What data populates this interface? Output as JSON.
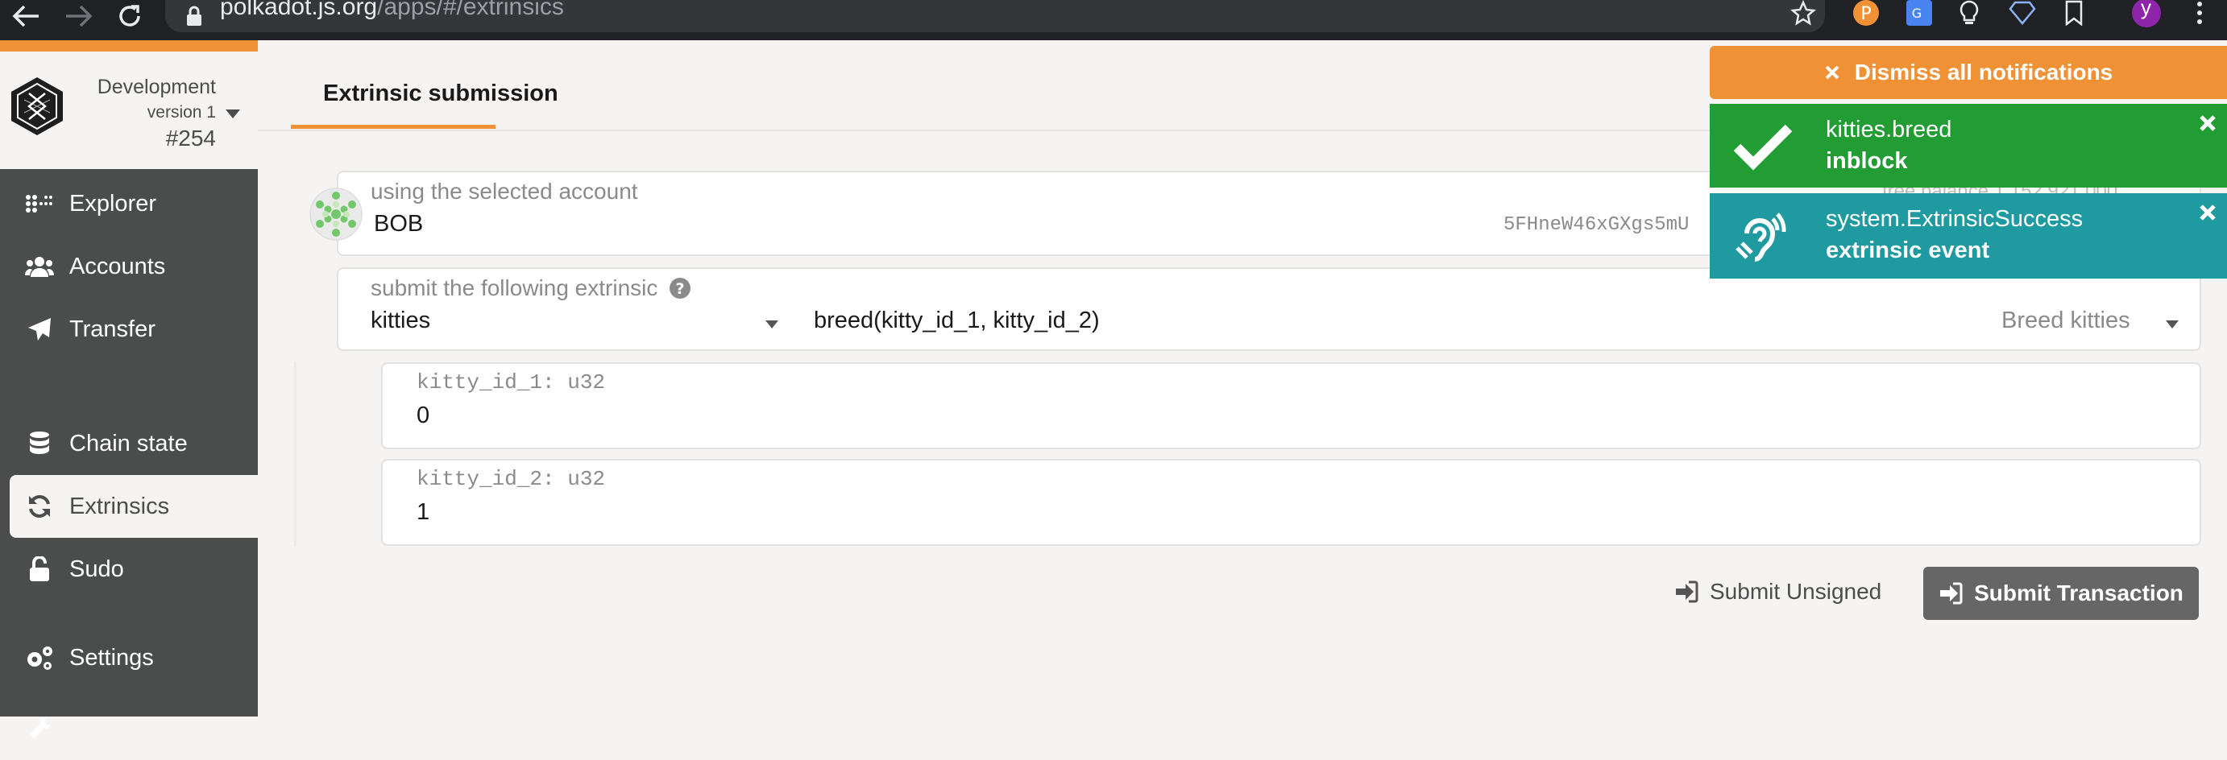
{
  "browser": {
    "url_host": "polkadot.js.org",
    "url_path": "/apps/#/extrinsics",
    "profile_initial": "y"
  },
  "sidebar": {
    "chain_name": "Development",
    "chain_version": "version 1",
    "block_number": "#254",
    "items": [
      {
        "label": "Explorer",
        "icon": "explorer-icon"
      },
      {
        "label": "Accounts",
        "icon": "users-icon"
      },
      {
        "label": "Transfer",
        "icon": "paper-plane-icon"
      },
      {
        "label": "Chain state",
        "icon": "database-icon"
      },
      {
        "label": "Extrinsics",
        "icon": "sync-icon",
        "active": true
      },
      {
        "label": "Sudo",
        "icon": "unlock-icon"
      },
      {
        "label": "Settings",
        "icon": "cogs-icon"
      }
    ]
  },
  "tab": {
    "label": "Extrinsic submission"
  },
  "account": {
    "label": "using the selected account",
    "name": "BOB",
    "address": "5FHneW46xGXgs5mU",
    "balance_text": "free balance 1.152.921.000"
  },
  "extrinsic": {
    "label": "submit the following extrinsic",
    "module": "kitties",
    "call": "breed(kitty_id_1, kitty_id_2)",
    "description": "Breed kitties"
  },
  "params": [
    {
      "label": "kitty_id_1: u32",
      "value": "0"
    },
    {
      "label": "kitty_id_2: u32",
      "value": "1"
    }
  ],
  "actions": {
    "unsigned_label": "Submit Unsigned",
    "submit_label": "Submit Transaction"
  },
  "notifications": {
    "dismiss_label": "Dismiss all notifications",
    "items": [
      {
        "title": "kitties.breed",
        "status": "inblock",
        "color": "#229d33",
        "icon": "check-icon"
      },
      {
        "title": "system.ExtrinsicSuccess",
        "status": "extrinsic event",
        "color": "#1f9aa0",
        "icon": "assistive-listening-icon"
      }
    ]
  },
  "colors": {
    "accent": "#f19135",
    "sidebar": "#4a4d4b",
    "success": "#229d33",
    "event": "#1f9aa0"
  }
}
